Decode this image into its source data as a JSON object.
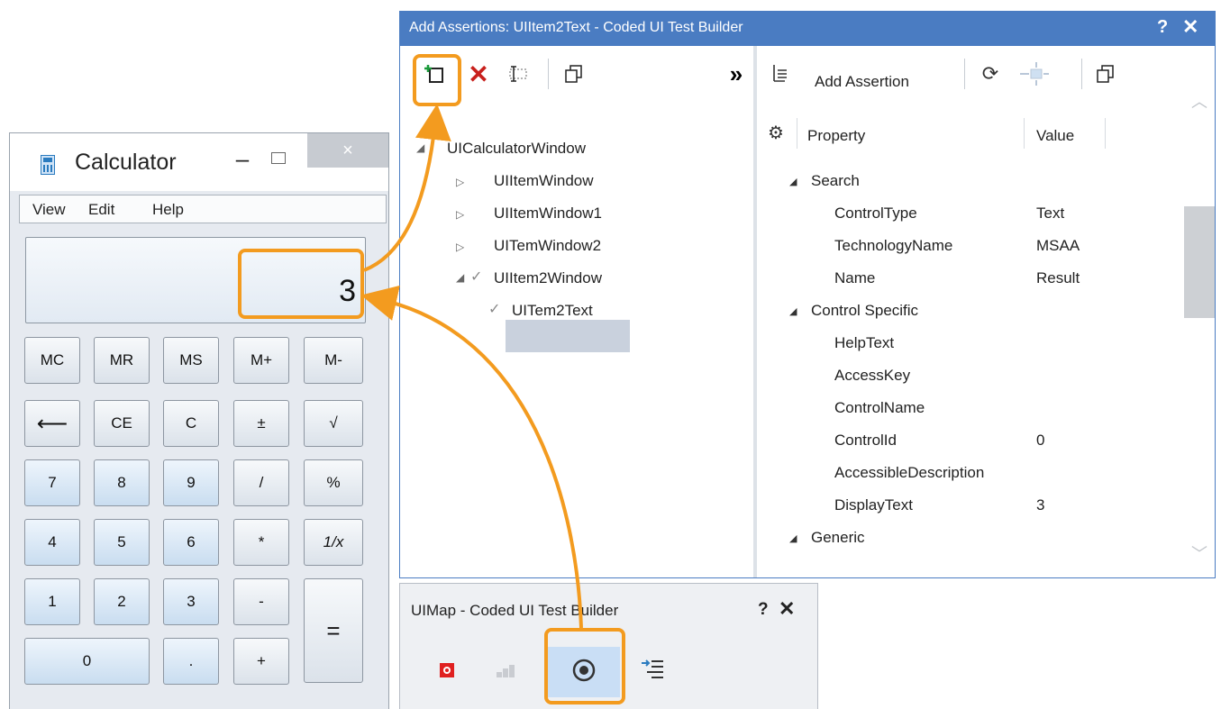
{
  "calculator": {
    "title": "Calculator",
    "min": "–",
    "close": "×",
    "menu": [
      "View",
      "Edit",
      "Help"
    ],
    "display_value": "3",
    "buttons": {
      "mc": "MC",
      "mr": "MR",
      "ms": "MS",
      "mplus": "M+",
      "mminus": "M-",
      "back": "⟵",
      "ce": "CE",
      "c": "C",
      "pm": "±",
      "sqrt": "√",
      "n7": "7",
      "n8": "8",
      "n9": "9",
      "div": "/",
      "pct": "%",
      "n4": "4",
      "n5": "5",
      "n6": "6",
      "mul": "*",
      "recip": "1/x",
      "n1": "1",
      "n2": "2",
      "n3": "3",
      "sub": "-",
      "eq": "=",
      "n0": "0",
      "dot": ".",
      "add": "+"
    }
  },
  "assertions": {
    "title": "Add Assertions: UIItem2Text - Coded UI Test Builder",
    "help": "?",
    "close": "✕",
    "toolbar": {
      "expand": "»",
      "add_assertion": "Add Assertion"
    },
    "tree": [
      "UICalculatorWindow",
      "UIItemWindow",
      "UIItemWindow1",
      "UITemWindow2",
      "UIItem2Window",
      "UITem2Text"
    ],
    "columns": {
      "property": "Property",
      "value": "Value"
    },
    "groups": {
      "search": "Search",
      "control_specific": "Control Specific",
      "generic": "Generic"
    },
    "properties": [
      {
        "name": "ControlType",
        "value": "Text"
      },
      {
        "name": "TechnologyName",
        "value": "MSAA"
      },
      {
        "name": "Name",
        "value": "Result"
      },
      {
        "name": "HelpText",
        "value": ""
      },
      {
        "name": "AccessKey",
        "value": ""
      },
      {
        "name": "ControlName",
        "value": ""
      },
      {
        "name": "ControlId",
        "value": "0"
      },
      {
        "name": "AccessibleDescription",
        "value": ""
      },
      {
        "name": "DisplayText",
        "value": "3"
      }
    ]
  },
  "uimap": {
    "title": "UIMap - Coded UI Test Builder",
    "help": "?",
    "close": "✕"
  },
  "colors": {
    "highlight": "#f39b1f",
    "title_bar": "#4a7cc2",
    "record_red": "#e02020"
  }
}
